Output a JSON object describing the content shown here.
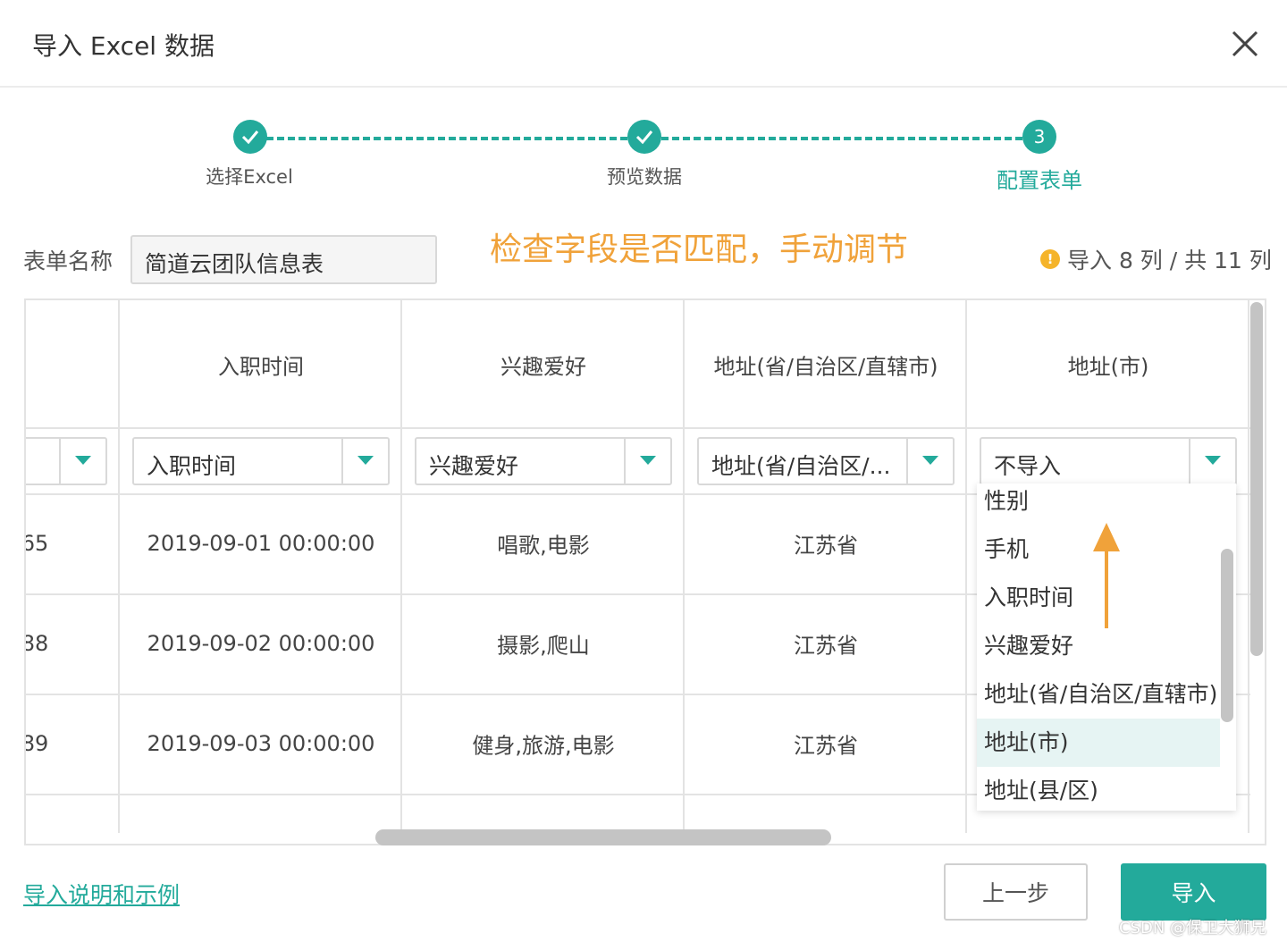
{
  "dialog": {
    "title": "导入 Excel 数据"
  },
  "steps": [
    {
      "label": "选择Excel",
      "state": "done"
    },
    {
      "label": "预览数据",
      "state": "done"
    },
    {
      "label": "配置表单",
      "number": "3",
      "state": "active"
    }
  ],
  "form": {
    "label": "表单名称",
    "name_value": "简道云团队信息表"
  },
  "annotation": "检查字段是否匹配，手动调节",
  "import_info": {
    "text": "导入 8 列 / 共 11 列"
  },
  "table": {
    "headers": [
      "入职时间",
      "兴趣爱好",
      "地址(省/自治区/直辖市)",
      "地址(市)"
    ],
    "mappings": [
      "",
      "入职时间",
      "兴趣爱好",
      "地址(省/自治区/...",
      "不导入"
    ],
    "rows": [
      [
        "65",
        "2019-09-01 00:00:00",
        "唱歌,电影",
        "江苏省"
      ],
      [
        "88",
        "2019-09-02 00:00:00",
        "摄影,爬山",
        "江苏省"
      ],
      [
        "89",
        "2019-09-03 00:00:00",
        "健身,旅游,电影",
        "江苏省"
      ]
    ]
  },
  "dropdown": {
    "options": [
      "性别",
      "手机",
      "入职时间",
      "兴趣爱好",
      "地址(省/自治区/直辖市)",
      "地址(市)",
      "地址(县/区)"
    ],
    "selected_index": 5
  },
  "footer": {
    "help_link": "导入说明和示例",
    "prev_label": "上一步",
    "import_label": "导入"
  },
  "watermark": "CSDN @保卫大狮兄",
  "colors": {
    "accent": "#23aa9b",
    "annotation": "#f0a23a",
    "warning": "#f5b42a"
  }
}
